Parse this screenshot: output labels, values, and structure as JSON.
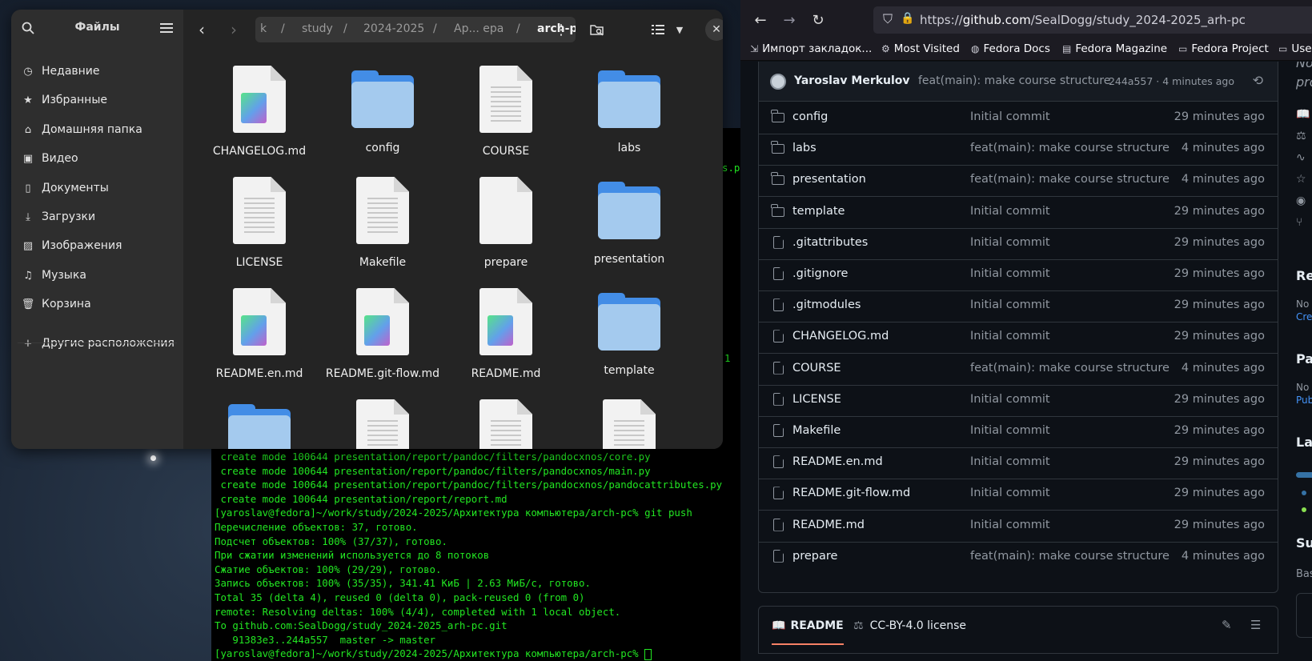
{
  "terminal": {
    "fragments": [
      "s.p",
      "1"
    ],
    "lines": [
      " create mode 100644 presentation/report/pandoc/filters/pandocxnos/core.py",
      " create mode 100644 presentation/report/pandoc/filters/pandocxnos/main.py",
      " create mode 100644 presentation/report/pandoc/filters/pandocxnos/pandocattributes.py",
      " create mode 100644 presentation/report/report.md",
      "[yaroslav@fedora]~/work/study/2024-2025/Архитектура компьютера/arch-pc% git push",
      "Перечисление объектов: 37, готово.",
      "Подсчет объектов: 100% (37/37), готово.",
      "При сжатии изменений используется до 8 потоков",
      "Сжатие объектов: 100% (29/29), готово.",
      "Запись объектов: 100% (35/35), 341.41 КиБ | 2.63 МиБ/с, готово.",
      "Total 35 (delta 4), reused 0 (delta 0), pack-reused 0 (from 0)",
      "remote: Resolving deltas: 100% (4/4), completed with 1 local object.",
      "To github.com:SealDogg/study_2024-2025_arh-pc.git",
      "   91383e3..244a557  master -> master"
    ],
    "prompt": "[yaroslav@fedora]~/work/study/2024-2025/Архитектура компьютера/arch-pc% "
  },
  "files": {
    "title": "Файлы",
    "sidebar": [
      {
        "icon": "clock-icon",
        "glyph": "◷",
        "label": "Недавние"
      },
      {
        "icon": "star-icon",
        "glyph": "★",
        "label": "Избранные"
      },
      {
        "icon": "home-icon",
        "glyph": "⌂",
        "label": "Домашняя папка"
      },
      {
        "icon": "video-icon",
        "glyph": "▣",
        "label": "Видео"
      },
      {
        "icon": "document-icon",
        "glyph": "▯",
        "label": "Документы"
      },
      {
        "icon": "download-icon",
        "glyph": "⤓",
        "label": "Загрузки"
      },
      {
        "icon": "image-icon",
        "glyph": "▨",
        "label": "Изображения"
      },
      {
        "icon": "music-icon",
        "glyph": "♫",
        "label": "Музыка"
      },
      {
        "icon": "trash-icon",
        "glyph": "🗑",
        "label": "Корзина"
      },
      {
        "icon": "plus-icon",
        "glyph": "+",
        "label": "Другие расположения"
      }
    ],
    "path": [
      "k",
      "/",
      "study",
      "/",
      "2024-2025",
      "/",
      "Ар... ера",
      "/",
      "arch-pc"
    ],
    "items": [
      {
        "name": "CHANGELOG.md",
        "kind": "md"
      },
      {
        "name": "config",
        "kind": "folder"
      },
      {
        "name": "COURSE",
        "kind": "text"
      },
      {
        "name": "labs",
        "kind": "folder"
      },
      {
        "name": "LICENSE",
        "kind": "text"
      },
      {
        "name": "Makefile",
        "kind": "text"
      },
      {
        "name": "prepare",
        "kind": "blank"
      },
      {
        "name": "presentation",
        "kind": "folder"
      },
      {
        "name": "README.en.md",
        "kind": "md"
      },
      {
        "name": "README.git-flow.md",
        "kind": "md"
      },
      {
        "name": "README.md",
        "kind": "md"
      },
      {
        "name": "template",
        "kind": "folder"
      },
      {
        "name": "",
        "kind": "folder"
      },
      {
        "name": "",
        "kind": "text"
      },
      {
        "name": "",
        "kind": "text"
      },
      {
        "name": "",
        "kind": "text"
      }
    ]
  },
  "browser": {
    "url_prefix": "https://",
    "url_host": "github.com",
    "url_path": "/SealDogg/study_2024-2025_arh-pc",
    "bookmarks": [
      {
        "icon": "import-icon",
        "glyph": "⇲",
        "label": "Импорт закладок..."
      },
      {
        "icon": "gear-icon",
        "glyph": "⚙",
        "label": "Most Visited"
      },
      {
        "icon": "globe-icon",
        "glyph": "◍",
        "label": "Fedora Docs"
      },
      {
        "icon": "fedora-magazine-icon",
        "glyph": "▤",
        "label": "Fedora Magazine"
      },
      {
        "icon": "folder-icon",
        "glyph": "▭",
        "label": "Fedora Project"
      },
      {
        "icon": "folder-icon",
        "glyph": "▭",
        "label": "Use"
      }
    ],
    "commit": {
      "author": "Yaroslav Merkulov",
      "message": "feat(main): make course structure",
      "meta": "244a557 · 4 minutes ago"
    },
    "rows": [
      {
        "type": "folder",
        "name": "config",
        "msg": "Initial commit",
        "ago": "29 minutes ago"
      },
      {
        "type": "folder",
        "name": "labs",
        "msg": "feat(main): make course structure",
        "ago": "4 minutes ago"
      },
      {
        "type": "folder",
        "name": "presentation",
        "msg": "feat(main): make course structure",
        "ago": "4 minutes ago"
      },
      {
        "type": "folder",
        "name": "template",
        "msg": "Initial commit",
        "ago": "29 minutes ago"
      },
      {
        "type": "file",
        "name": ".gitattributes",
        "msg": "Initial commit",
        "ago": "29 minutes ago"
      },
      {
        "type": "file",
        "name": ".gitignore",
        "msg": "Initial commit",
        "ago": "29 minutes ago"
      },
      {
        "type": "file",
        "name": ".gitmodules",
        "msg": "Initial commit",
        "ago": "29 minutes ago"
      },
      {
        "type": "file",
        "name": "CHANGELOG.md",
        "msg": "Initial commit",
        "ago": "29 minutes ago"
      },
      {
        "type": "file",
        "name": "COURSE",
        "msg": "feat(main): make course structure",
        "ago": "4 minutes ago"
      },
      {
        "type": "file",
        "name": "LICENSE",
        "msg": "Initial commit",
        "ago": "29 minutes ago"
      },
      {
        "type": "file",
        "name": "Makefile",
        "msg": "Initial commit",
        "ago": "29 minutes ago"
      },
      {
        "type": "file",
        "name": "README.en.md",
        "msg": "Initial commit",
        "ago": "29 minutes ago"
      },
      {
        "type": "file",
        "name": "README.git-flow.md",
        "msg": "Initial commit",
        "ago": "29 minutes ago"
      },
      {
        "type": "file",
        "name": "README.md",
        "msg": "Initial commit",
        "ago": "29 minutes ago"
      },
      {
        "type": "file",
        "name": "prepare",
        "msg": "feat(main): make course structure",
        "ago": "4 minutes ago"
      }
    ],
    "readme_tab": "README",
    "license_tab": "CC-BY-4.0 license",
    "right_column": [
      "No",
      "pro",
      "Re",
      "No",
      "Cre",
      "Pa",
      "No",
      "Pub",
      "La",
      "Su",
      "Bas"
    ]
  }
}
